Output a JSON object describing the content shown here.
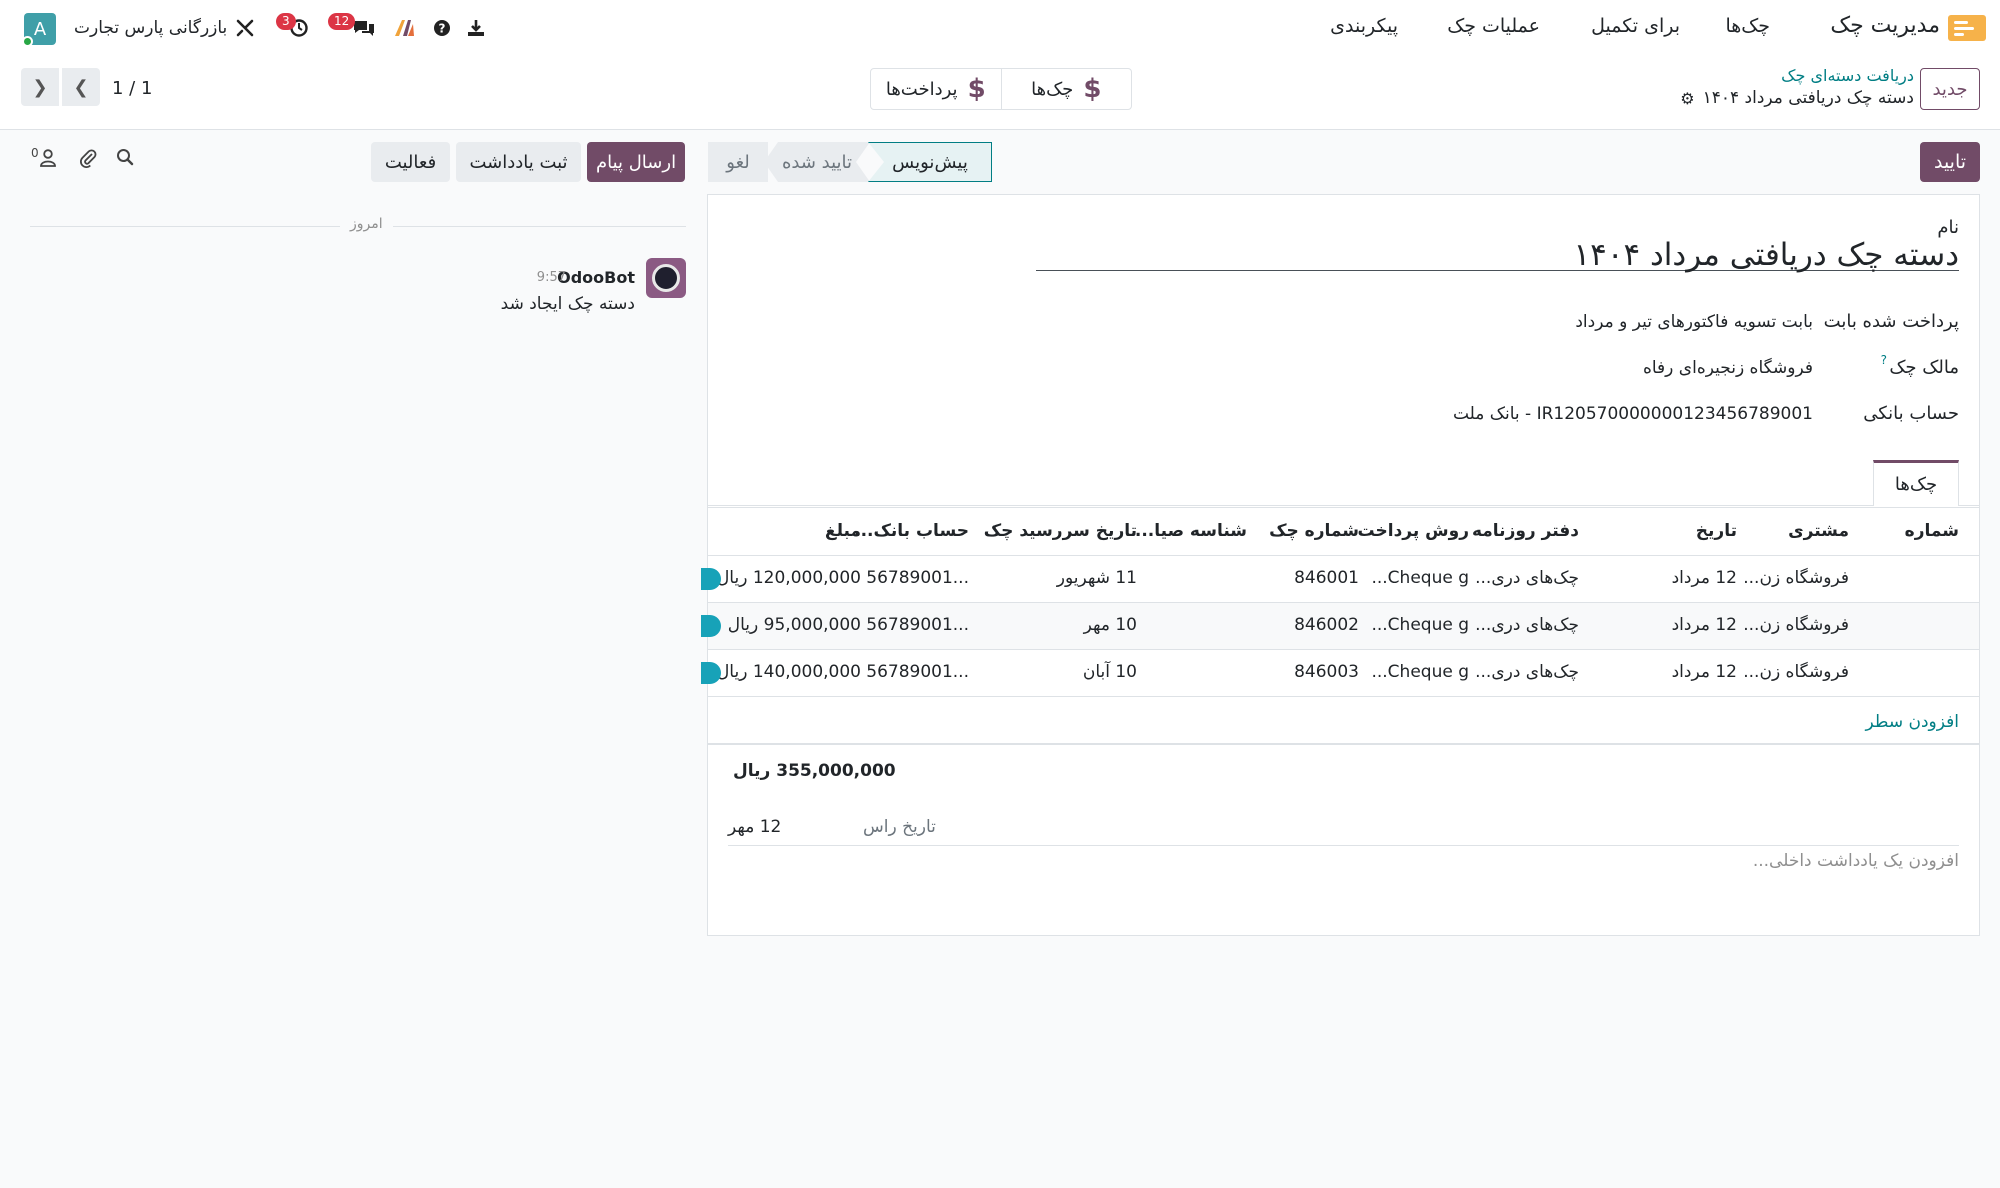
{
  "navbar": {
    "app_name": "مدیریت چک",
    "menu": [
      "چک‌ها",
      "برای تکمیل",
      "عملیات چک",
      "پیکربندی"
    ],
    "company": "بازرگانی پارس تجارت",
    "activity_badge": "3",
    "messages_badge": "12",
    "avatar_letter": "A"
  },
  "control": {
    "new_label": "جدید",
    "breadcrumb_parent": "دریافت دسته‌ای چک",
    "breadcrumb_current": "دسته چک دریافتی مرداد ۱۴۰۴",
    "smart_checks": "چک‌ها",
    "smart_payments": "پرداخت‌ها",
    "pager": "1 / 1"
  },
  "status": {
    "confirm_label": "تایید",
    "stages": [
      "پیش‌نویس",
      "تایید شده",
      "لغو"
    ]
  },
  "form": {
    "name_label": "نام",
    "name_value": "دسته چک دریافتی مرداد ۱۴۰۴",
    "paid_for_label": "پرداخت شده بابت",
    "paid_for_value": "بابت تسویه فاکتورهای تیر و مرداد",
    "owner_label": "مالک چک",
    "owner_help": "?",
    "owner_value": "فروشگاه زنجیره‌ای رفاه",
    "bank_label": "حساب بانکی",
    "bank_value": "IR120570000000123456789001 - بانک ملت",
    "tab_label": "چک‌ها",
    "columns": [
      "شماره",
      "مشتری",
      "تاریخ",
      "دفتر روزنامه",
      "روش پرداخت",
      "شماره چک",
      "شناسه صیا...",
      "تاریخ سررسید چک",
      "حساب بانک...",
      "مبلغ"
    ],
    "rows": [
      {
        "customer": "فروشگاه زن...",
        "date": "12 مرداد",
        "journal": "چک‌های دری...",
        "method": "Cheque g...",
        "check_no": "846001",
        "due": "11 شهریور",
        "bank": "...56789001",
        "amount": "120,000,000 ریال"
      },
      {
        "customer": "فروشگاه زن...",
        "date": "12 مرداد",
        "journal": "چک‌های دری...",
        "method": "Cheque g...",
        "check_no": "846002",
        "due": "10 مهر",
        "bank": "...56789001",
        "amount": "95,000,000 ریال"
      },
      {
        "customer": "فروشگاه زن...",
        "date": "12 مرداد",
        "journal": "چک‌های دری...",
        "method": "Cheque g...",
        "check_no": "846003",
        "due": "10 آبان",
        "bank": "...56789001",
        "amount": "140,000,000 ریال"
      }
    ],
    "add_line": "افزودن سطر",
    "total": "355,000,000 ریال",
    "due_label": "تاریخ راس",
    "due_value": "12 مهر",
    "note_placeholder": "افزودن یک یادداشت داخلی..."
  },
  "chatter": {
    "send_message": "ارسال پیام",
    "log_note": "ثبت یادداشت",
    "activity": "فعالیت",
    "followers_count": "0",
    "today": "امروز",
    "author": "OdooBot",
    "time": "9:57",
    "message": "دسته چک ایجاد شد"
  },
  "colors": {
    "primary": "#714b67",
    "link": "#017e84",
    "badge": "#dc3545"
  }
}
